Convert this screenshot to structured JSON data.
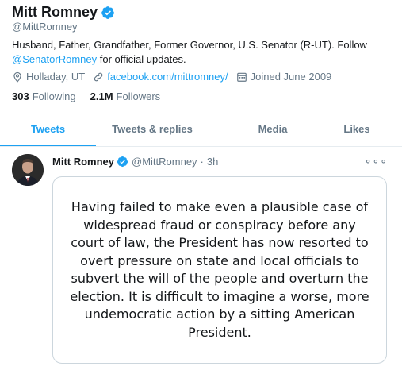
{
  "profile": {
    "name": "Mitt Romney",
    "handle": "@MittRomney",
    "bio_text": "Husband, Father, Grandfather, Former Governor, U.S. Senator (R-UT). Follow ",
    "bio_link": "@SenatorRomney",
    "bio_tail": " for official updates.",
    "location": "Holladay, UT",
    "website": "facebook.com/mittromney/",
    "joined": "Joined June 2009",
    "following_count": "303",
    "following_label": "Following",
    "followers_count": "2.1M",
    "followers_label": "Followers"
  },
  "tabs": [
    {
      "label": "Tweets"
    },
    {
      "label": "Tweets & replies"
    },
    {
      "label": "Media"
    },
    {
      "label": "Likes"
    }
  ],
  "tweet": {
    "name": "Mitt Romney",
    "handle": "@MittRomney",
    "separator": "·",
    "time": "3h",
    "more": "∘∘∘",
    "image_text": "Having failed to make even a plausible case of widespread fraud or conspiracy before any court of law, the President has now resorted to overt pressure on state and local officials to subvert the will of the people and overturn the election. It is difficult to imagine a worse, more undemocratic action by a sitting American President."
  },
  "colors": {
    "accent": "#1da1f2",
    "muted": "#657786",
    "text": "#14171a",
    "border": "#e6ecf0"
  },
  "icons": [
    "verified-badge-icon",
    "location-icon",
    "link-icon",
    "calendar-icon",
    "more-icon"
  ]
}
